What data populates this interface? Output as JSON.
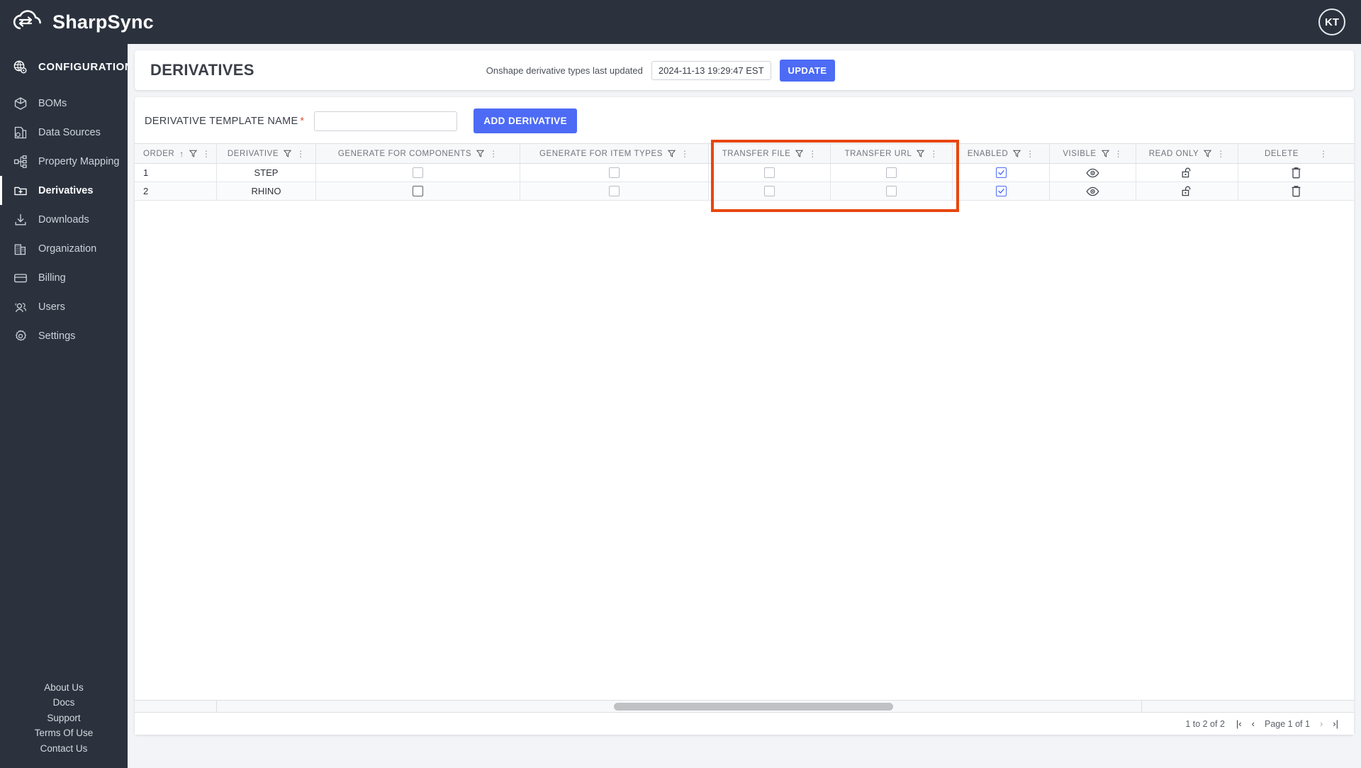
{
  "app": {
    "brand": "SharpSync",
    "avatar_initials": "KT",
    "brand_icon": "cloud-sync-icon"
  },
  "sidebar": {
    "section_title": "CONFIGURATION",
    "section_icon": "globe-gear-icon",
    "items": [
      {
        "label": "BOMs",
        "icon": "cube-icon",
        "active": false
      },
      {
        "label": "Data Sources",
        "icon": "data-source-icon",
        "active": false
      },
      {
        "label": "Property Mapping",
        "icon": "node-tree-icon",
        "active": false
      },
      {
        "label": "Derivatives",
        "icon": "folder-plus-icon",
        "active": true
      },
      {
        "label": "Downloads",
        "icon": "download-icon",
        "active": false
      },
      {
        "label": "Organization",
        "icon": "building-icon",
        "active": false
      },
      {
        "label": "Billing",
        "icon": "credit-card-icon",
        "active": false
      },
      {
        "label": "Users",
        "icon": "users-icon",
        "active": false
      },
      {
        "label": "Settings",
        "icon": "gear-icon",
        "active": false
      }
    ],
    "footer_links": [
      "About Us",
      "Docs",
      "Support",
      "Terms Of Use",
      "Contact Us"
    ]
  },
  "header": {
    "title": "DERIVATIVES",
    "updated_label": "Onshape derivative types last updated",
    "updated_value": "2024-11-13 19:29:47 EST",
    "update_button": "UPDATE"
  },
  "form": {
    "label": "DERIVATIVE TEMPLATE NAME",
    "required_marker": "*",
    "input_value": "",
    "input_placeholder": "",
    "add_button": "ADD DERIVATIVE"
  },
  "table": {
    "columns": [
      {
        "label": "ORDER",
        "sorted": "asc",
        "sort_glyph": "↑",
        "filter": true,
        "menu": true
      },
      {
        "label": "DERIVATIVE",
        "filter": true,
        "menu": true
      },
      {
        "label": "GENERATE FOR COMPONENTS",
        "filter": true,
        "menu": true
      },
      {
        "label": "GENERATE FOR ITEM TYPES",
        "filter": true,
        "menu": true
      },
      {
        "label": "TRANSFER FILE",
        "filter": true,
        "menu": true,
        "highlighted": true
      },
      {
        "label": "TRANSFER URL",
        "filter": true,
        "menu": true,
        "highlighted": true
      },
      {
        "label": "ENABLED",
        "filter": true,
        "menu": true
      },
      {
        "label": "VISIBLE",
        "filter": true,
        "menu": true
      },
      {
        "label": "READ ONLY",
        "filter": true,
        "menu": true
      },
      {
        "label": "DELETE",
        "filter": false,
        "menu": true
      }
    ],
    "rows": [
      {
        "order": "1",
        "derivative": "STEP",
        "generate_for_components": false,
        "generate_for_item_types": false,
        "transfer_file": false,
        "transfer_url": false,
        "enabled": true,
        "visible_icon": "eye-icon",
        "read_only_icon": "unlock-icon",
        "delete_icon": "trash-icon"
      },
      {
        "order": "2",
        "derivative": "RHINO",
        "generate_for_components": false,
        "generate_for_item_types": false,
        "transfer_file": false,
        "transfer_url": false,
        "enabled": true,
        "visible_icon": "eye-icon",
        "read_only_icon": "unlock-icon",
        "delete_icon": "trash-icon"
      }
    ]
  },
  "pagination": {
    "range_text": "1 to 2 of 2",
    "page_text": "Page 1 of 1",
    "first_glyph": "|‹",
    "prev_glyph": "‹",
    "next_glyph": "›",
    "last_glyph": "›|"
  },
  "annotation": {
    "color": "#e8460d",
    "target": "transfer-file-and-url-columns"
  }
}
